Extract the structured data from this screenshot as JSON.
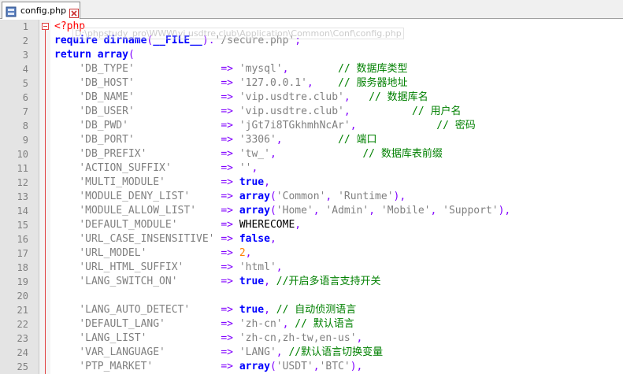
{
  "tab": {
    "filename": "config.php",
    "icon": "php-file-icon",
    "close_icon": "close-icon"
  },
  "tooltip": {
    "path": "D:\\phpstudy_pro\\WWW\\vi.usdtre.club\\Application\\Common\\Conf\\config.php"
  },
  "lines": [
    {
      "n": "1",
      "tokens": [
        [
          "tag",
          "<?php"
        ]
      ]
    },
    {
      "n": "2",
      "tokens": [
        [
          "kw",
          "require"
        ],
        [
          "const",
          " "
        ],
        [
          "kw",
          "dirname"
        ],
        [
          "op",
          "("
        ],
        [
          "kw",
          "__FILE__"
        ],
        [
          "op",
          ")."
        ],
        [
          "str",
          "'/secure.php'"
        ],
        [
          "op",
          ";"
        ]
      ]
    },
    {
      "n": "3",
      "tokens": [
        [
          "kw",
          "return"
        ],
        [
          "const",
          " "
        ],
        [
          "kw",
          "array"
        ],
        [
          "op",
          "("
        ]
      ]
    },
    {
      "n": "4",
      "tokens": [
        [
          "const",
          "    "
        ],
        [
          "str",
          "'DB_TYPE'"
        ],
        [
          "const",
          "              "
        ],
        [
          "op",
          "=>"
        ],
        [
          "const",
          " "
        ],
        [
          "str",
          "'mysql'"
        ],
        [
          "op",
          ","
        ],
        [
          "const",
          "        "
        ],
        [
          "cmt",
          "// 数据库类型"
        ]
      ]
    },
    {
      "n": "5",
      "tokens": [
        [
          "const",
          "    "
        ],
        [
          "str",
          "'DB_HOST'"
        ],
        [
          "const",
          "              "
        ],
        [
          "op",
          "=>"
        ],
        [
          "const",
          " "
        ],
        [
          "str",
          "'127.0.0.1'"
        ],
        [
          "op",
          ","
        ],
        [
          "const",
          "    "
        ],
        [
          "cmt",
          "// 服务器地址"
        ]
      ]
    },
    {
      "n": "6",
      "tokens": [
        [
          "const",
          "    "
        ],
        [
          "str",
          "'DB_NAME'"
        ],
        [
          "const",
          "              "
        ],
        [
          "op",
          "=>"
        ],
        [
          "const",
          " "
        ],
        [
          "str",
          "'vip.usdtre.club'"
        ],
        [
          "op",
          ","
        ],
        [
          "const",
          "   "
        ],
        [
          "cmt",
          "// 数据库名"
        ]
      ]
    },
    {
      "n": "7",
      "tokens": [
        [
          "const",
          "    "
        ],
        [
          "str",
          "'DB_USER'"
        ],
        [
          "const",
          "              "
        ],
        [
          "op",
          "=>"
        ],
        [
          "const",
          " "
        ],
        [
          "str",
          "'vip.usdtre.club'"
        ],
        [
          "op",
          ","
        ],
        [
          "const",
          "          "
        ],
        [
          "cmt",
          "// 用户名"
        ]
      ]
    },
    {
      "n": "8",
      "tokens": [
        [
          "const",
          "    "
        ],
        [
          "str",
          "'DB_PWD'"
        ],
        [
          "const",
          "               "
        ],
        [
          "op",
          "=>"
        ],
        [
          "const",
          " "
        ],
        [
          "str",
          "'jGt7i8TGkhmhNcAr'"
        ],
        [
          "op",
          ","
        ],
        [
          "const",
          "             "
        ],
        [
          "cmt",
          "// 密码"
        ]
      ]
    },
    {
      "n": "9",
      "tokens": [
        [
          "const",
          "    "
        ],
        [
          "str",
          "'DB_PORT'"
        ],
        [
          "const",
          "              "
        ],
        [
          "op",
          "=>"
        ],
        [
          "const",
          " "
        ],
        [
          "str",
          "'3306'"
        ],
        [
          "op",
          ","
        ],
        [
          "const",
          "         "
        ],
        [
          "cmt",
          "// 端口"
        ]
      ]
    },
    {
      "n": "10",
      "tokens": [
        [
          "const",
          "    "
        ],
        [
          "str",
          "'DB_PREFIX'"
        ],
        [
          "const",
          "            "
        ],
        [
          "op",
          "=>"
        ],
        [
          "const",
          " "
        ],
        [
          "str",
          "'tw_'"
        ],
        [
          "op",
          ","
        ],
        [
          "const",
          "              "
        ],
        [
          "cmt",
          "// 数据库表前缀"
        ]
      ]
    },
    {
      "n": "11",
      "tokens": [
        [
          "const",
          "    "
        ],
        [
          "str",
          "'ACTION_SUFFIX'"
        ],
        [
          "const",
          "        "
        ],
        [
          "op",
          "=>"
        ],
        [
          "const",
          " "
        ],
        [
          "str",
          "''"
        ],
        [
          "op",
          ","
        ]
      ]
    },
    {
      "n": "12",
      "tokens": [
        [
          "const",
          "    "
        ],
        [
          "str",
          "'MULTI_MODULE'"
        ],
        [
          "const",
          "         "
        ],
        [
          "op",
          "=>"
        ],
        [
          "const",
          " "
        ],
        [
          "kw",
          "true"
        ],
        [
          "op",
          ","
        ]
      ]
    },
    {
      "n": "13",
      "tokens": [
        [
          "const",
          "    "
        ],
        [
          "str",
          "'MODULE_DENY_LIST'"
        ],
        [
          "const",
          "     "
        ],
        [
          "op",
          "=>"
        ],
        [
          "const",
          " "
        ],
        [
          "kw",
          "array"
        ],
        [
          "op",
          "("
        ],
        [
          "str",
          "'Common'"
        ],
        [
          "op",
          ", "
        ],
        [
          "str",
          "'Runtime'"
        ],
        [
          "op",
          "),"
        ]
      ]
    },
    {
      "n": "14",
      "tokens": [
        [
          "const",
          "    "
        ],
        [
          "str",
          "'MODULE_ALLOW_LIST'"
        ],
        [
          "const",
          "    "
        ],
        [
          "op",
          "=>"
        ],
        [
          "const",
          " "
        ],
        [
          "kw",
          "array"
        ],
        [
          "op",
          "("
        ],
        [
          "str",
          "'Home'"
        ],
        [
          "op",
          ", "
        ],
        [
          "str",
          "'Admin'"
        ],
        [
          "op",
          ", "
        ],
        [
          "str",
          "'Mobile'"
        ],
        [
          "op",
          ", "
        ],
        [
          "str",
          "'Support'"
        ],
        [
          "op",
          "),"
        ]
      ]
    },
    {
      "n": "15",
      "tokens": [
        [
          "const",
          "    "
        ],
        [
          "str",
          "'DEFAULT_MODULE'"
        ],
        [
          "const",
          "       "
        ],
        [
          "op",
          "=>"
        ],
        [
          "const",
          " WHERECOME"
        ],
        [
          "op",
          ","
        ]
      ]
    },
    {
      "n": "16",
      "tokens": [
        [
          "const",
          "    "
        ],
        [
          "str",
          "'URL_CASE_INSENSITIVE'"
        ],
        [
          "const",
          " "
        ],
        [
          "op",
          "=>"
        ],
        [
          "const",
          " "
        ],
        [
          "kw",
          "false"
        ],
        [
          "op",
          ","
        ]
      ]
    },
    {
      "n": "17",
      "tokens": [
        [
          "const",
          "    "
        ],
        [
          "str",
          "'URL_MODEL'"
        ],
        [
          "const",
          "            "
        ],
        [
          "op",
          "=>"
        ],
        [
          "const",
          " "
        ],
        [
          "num",
          "2"
        ],
        [
          "op",
          ","
        ]
      ]
    },
    {
      "n": "18",
      "tokens": [
        [
          "const",
          "    "
        ],
        [
          "str",
          "'URL_HTML_SUFFIX'"
        ],
        [
          "const",
          "      "
        ],
        [
          "op",
          "=>"
        ],
        [
          "const",
          " "
        ],
        [
          "str",
          "'html'"
        ],
        [
          "op",
          ","
        ]
      ]
    },
    {
      "n": "19",
      "tokens": [
        [
          "const",
          "    "
        ],
        [
          "str",
          "'LANG_SWITCH_ON'"
        ],
        [
          "const",
          "       "
        ],
        [
          "op",
          "=>"
        ],
        [
          "const",
          " "
        ],
        [
          "kw",
          "true"
        ],
        [
          "op",
          ","
        ],
        [
          "const",
          " "
        ],
        [
          "cmt",
          "//开启多语言支持开关"
        ]
      ]
    },
    {
      "n": "20",
      "tokens": []
    },
    {
      "n": "21",
      "tokens": [
        [
          "const",
          "    "
        ],
        [
          "str",
          "'LANG_AUTO_DETECT'"
        ],
        [
          "const",
          "     "
        ],
        [
          "op",
          "=>"
        ],
        [
          "const",
          " "
        ],
        [
          "kw",
          "true"
        ],
        [
          "op",
          ","
        ],
        [
          "const",
          " "
        ],
        [
          "cmt",
          "// 自动侦测语言"
        ]
      ]
    },
    {
      "n": "22",
      "tokens": [
        [
          "const",
          "    "
        ],
        [
          "str",
          "'DEFAULT_LANG'"
        ],
        [
          "const",
          "         "
        ],
        [
          "op",
          "=>"
        ],
        [
          "const",
          " "
        ],
        [
          "str",
          "'zh-cn'"
        ],
        [
          "op",
          ","
        ],
        [
          "const",
          " "
        ],
        [
          "cmt",
          "// 默认语言"
        ]
      ]
    },
    {
      "n": "23",
      "tokens": [
        [
          "const",
          "    "
        ],
        [
          "str",
          "'LANG_LIST'"
        ],
        [
          "const",
          "            "
        ],
        [
          "op",
          "=>"
        ],
        [
          "const",
          " "
        ],
        [
          "str",
          "'zh-cn,zh-tw,en-us'"
        ],
        [
          "op",
          ","
        ]
      ]
    },
    {
      "n": "24",
      "tokens": [
        [
          "const",
          "    "
        ],
        [
          "str",
          "'VAR_LANGUAGE'"
        ],
        [
          "const",
          "         "
        ],
        [
          "op",
          "=>"
        ],
        [
          "const",
          " "
        ],
        [
          "str",
          "'LANG'"
        ],
        [
          "op",
          ","
        ],
        [
          "const",
          " "
        ],
        [
          "cmt",
          "//默认语言切换变量"
        ]
      ]
    },
    {
      "n": "25",
      "tokens": [
        [
          "const",
          "    "
        ],
        [
          "str",
          "'PTP_MARKET'"
        ],
        [
          "const",
          "           "
        ],
        [
          "op",
          "=>"
        ],
        [
          "const",
          " "
        ],
        [
          "kw",
          "array"
        ],
        [
          "op",
          "("
        ],
        [
          "str",
          "'USDT'"
        ],
        [
          "op",
          ","
        ],
        [
          "str",
          "'BTC'"
        ],
        [
          "op",
          "),"
        ]
      ]
    }
  ]
}
